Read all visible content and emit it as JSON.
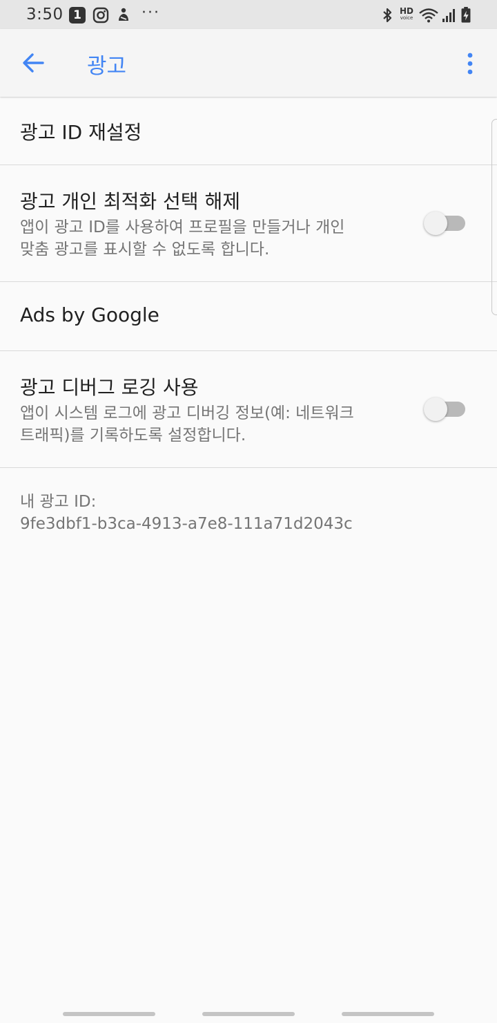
{
  "status_bar": {
    "time": "3:50",
    "notification_badge": "1",
    "more_notifications": "···",
    "hd_voice": {
      "hd": "HD",
      "voice": "voice"
    },
    "icons": [
      "number-badge-icon",
      "instagram-icon",
      "app-notification-icon",
      "more-dots-icon",
      "bluetooth-icon",
      "hd-voice-icon",
      "wifi-icon",
      "cell-signal-icon",
      "battery-charging-icon"
    ]
  },
  "app_bar": {
    "title": "광고",
    "back_icon": "back-arrow-icon",
    "more_icon": "more-vert-icon",
    "accent_color": "#4285f4"
  },
  "settings": {
    "reset_ad_id": {
      "title": "광고 ID 재설정"
    },
    "opt_out": {
      "title": "광고 개인 최적화 선택 해제",
      "line1": "앱이 광고 ID를 사용하여 프로필을 만들거나 개인",
      "line2": "맞춤 광고를 표시할 수 없도록 합니다.",
      "enabled": false
    },
    "ads_by_google": {
      "title": "Ads by Google"
    },
    "debug_logging": {
      "title": "광고 디버그 로깅 사용",
      "line1": "앱이 시스템 로그에 광고 디버깅 정보(예: 네트워크",
      "line2": "트래픽)를 기록하도록 설정합니다.",
      "enabled": false
    }
  },
  "ad_id": {
    "label": "내 광고 ID:",
    "value": "9fe3dbf1-b3ca-4913-a7e8-111a71d2043c"
  }
}
